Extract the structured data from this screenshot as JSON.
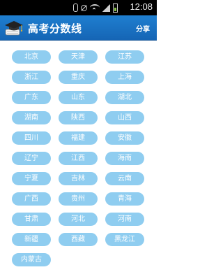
{
  "status_bar": {
    "time": "12:08"
  },
  "header": {
    "title": "高考分数线",
    "share_label": "分享"
  },
  "provinces": [
    "北京",
    "天津",
    "江苏",
    "浙江",
    "重庆",
    "上海",
    "广东",
    "山东",
    "湖北",
    "湖南",
    "陕西",
    "山西",
    "四川",
    "福建",
    "安徽",
    "辽宁",
    "江西",
    "海南",
    "宁夏",
    "吉林",
    "云南",
    "广西",
    "贵州",
    "青海",
    "甘肃",
    "河北",
    "河南",
    "新疆",
    "西藏",
    "黑龙江",
    "内蒙古"
  ],
  "colors": {
    "header": "#1a72c2",
    "button": "#8fcdf0",
    "status_bar": "#000000"
  }
}
